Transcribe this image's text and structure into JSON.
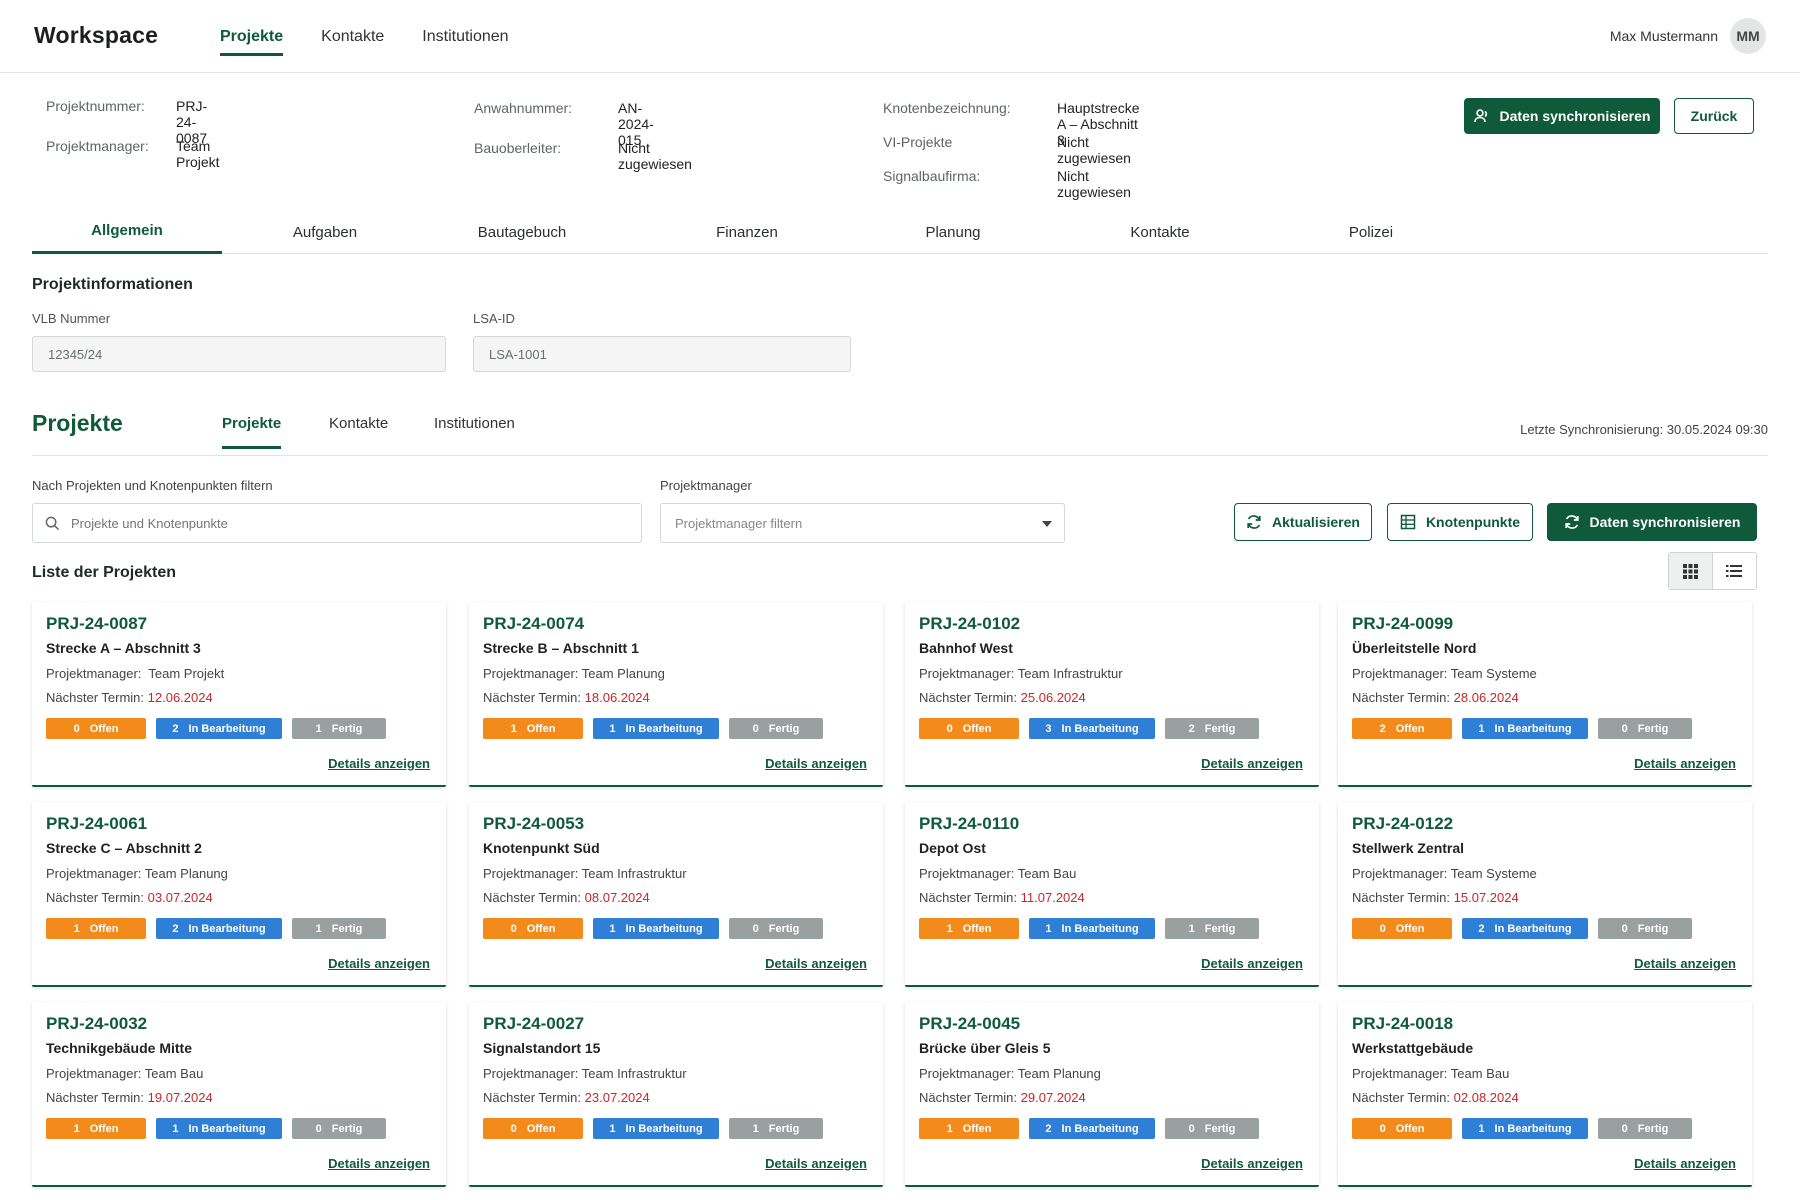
{
  "app": {
    "brand": "Workspace",
    "nav": [
      "Projekte",
      "Kontakte",
      "Institutionen"
    ],
    "user": {
      "name": "Max Mustermann",
      "initials": "MM"
    }
  },
  "header": {
    "fields": {
      "projektnummer": {
        "label": "Projektnummer:",
        "value": "PRJ-24-0087"
      },
      "projektmanager": {
        "label": "Projektmanager:",
        "value": "Team Projekt"
      },
      "anwahnummer": {
        "label": "Anwahnummer:",
        "value": "AN-2024-015"
      },
      "bauoberleiter": {
        "label": "Bauoberleiter:",
        "value": "Nicht zugewiesen"
      },
      "knotenbezeichnung": {
        "label": "Knotenbezeichnung:",
        "value": "Hauptstrecke A – Abschnitt 3"
      },
      "vi_projekte": {
        "label": "VI-Projekte",
        "value": "Nicht zugewiesen"
      },
      "signalbaufirma": {
        "label": "Signalbaufirma:",
        "value": "Nicht zugewiesen"
      }
    },
    "sync_button": "Daten synchronisieren",
    "back_button": "Zurück"
  },
  "tabs": [
    "Allgemein",
    "Aufgaben",
    "Bautagebuch",
    "Finanzen",
    "Planung",
    "Kontakte",
    "Polizei"
  ],
  "project_info": {
    "title": "Projektinformationen",
    "vlb": {
      "label": "VLB Nummer",
      "value": "12345/24"
    },
    "lsa": {
      "label": "LSA-ID",
      "value": "LSA-1001"
    }
  },
  "projects": {
    "title": "Projekte",
    "subtabs": [
      "Projekte",
      "Kontakte",
      "Institutionen"
    ],
    "last_sync": "Letzte Synchronisierung: 30.05.2024 09:30",
    "filter_label": "Nach Projekten und Knotenpunkten filtern",
    "search_placeholder": "Projekte und Knotenpunkte",
    "pm_label": "Projektmanager",
    "pm_placeholder": "Projektmanager filtern",
    "refresh_button": "Aktualisieren",
    "knoten_button": "Knotenpunkte",
    "sync_button": "Daten synchronisieren",
    "list_title": "Liste der Projekten",
    "pm_prefix": "Projektmanager:",
    "date_prefix": "Nächster Termin:",
    "status_labels": {
      "offen": "Offen",
      "bearb": "In Bearbeitung",
      "fertig": "Fertig"
    },
    "details_label": "Details anzeigen",
    "cards": [
      {
        "id": "PRJ-24-0087",
        "name": "Strecke A – Abschnitt 3",
        "pm": "Team Projekt",
        "date": "12.06.2024",
        "offen": "0",
        "bearb": "2",
        "fertig": "1"
      },
      {
        "id": "PRJ-24-0074",
        "name": "Strecke B – Abschnitt 1",
        "pm": "Team Planung",
        "date": "18.06.2024",
        "offen": "1",
        "bearb": "1",
        "fertig": "0"
      },
      {
        "id": "PRJ-24-0102",
        "name": "Bahnhof West",
        "pm": "Team Infrastruktur",
        "date": "25.06.2024",
        "offen": "0",
        "bearb": "3",
        "fertig": "2"
      },
      {
        "id": "PRJ-24-0099",
        "name": "Überleitstelle Nord",
        "pm": "Team Systeme",
        "date": "28.06.2024",
        "offen": "2",
        "bearb": "1",
        "fertig": "0"
      },
      {
        "id": "PRJ-24-0061",
        "name": "Strecke C – Abschnitt 2",
        "pm": "Team Planung",
        "date": "03.07.2024",
        "offen": "1",
        "bearb": "2",
        "fertig": "1"
      },
      {
        "id": "PRJ-24-0053",
        "name": "Knotenpunkt Süd",
        "pm": "Team Infrastruktur",
        "date": "08.07.2024",
        "offen": "0",
        "bearb": "1",
        "fertig": "0"
      },
      {
        "id": "PRJ-24-0110",
        "name": "Depot Ost",
        "pm": "Team Bau",
        "date": "11.07.2024",
        "offen": "1",
        "bearb": "1",
        "fertig": "1"
      },
      {
        "id": "PRJ-24-0122",
        "name": "Stellwerk Zentral",
        "pm": "Team Systeme",
        "date": "15.07.2024",
        "offen": "0",
        "bearb": "2",
        "fertig": "0"
      },
      {
        "id": "PRJ-24-0032",
        "name": "Technikgebäude Mitte",
        "pm": "Team Bau",
        "date": "19.07.2024",
        "offen": "1",
        "bearb": "1",
        "fertig": "0"
      },
      {
        "id": "PRJ-24-0027",
        "name": "Signalstandort 15",
        "pm": "Team Infrastruktur",
        "date": "23.07.2024",
        "offen": "0",
        "bearb": "1",
        "fertig": "1"
      },
      {
        "id": "PRJ-24-0045",
        "name": "Brücke über Gleis 5",
        "pm": "Team Planung",
        "date": "29.07.2024",
        "offen": "1",
        "bearb": "2",
        "fertig": "0"
      },
      {
        "id": "PRJ-24-0018",
        "name": "Werkstattgebäude",
        "pm": "Team Bau",
        "date": "02.08.2024",
        "offen": "0",
        "bearb": "1",
        "fertig": "0"
      }
    ]
  },
  "colors": {
    "primary": "#0e5a3a",
    "offen": "#f28a1c",
    "bearb": "#2f7fd6",
    "fertig": "#9aa0a0",
    "date": "#c62828"
  }
}
